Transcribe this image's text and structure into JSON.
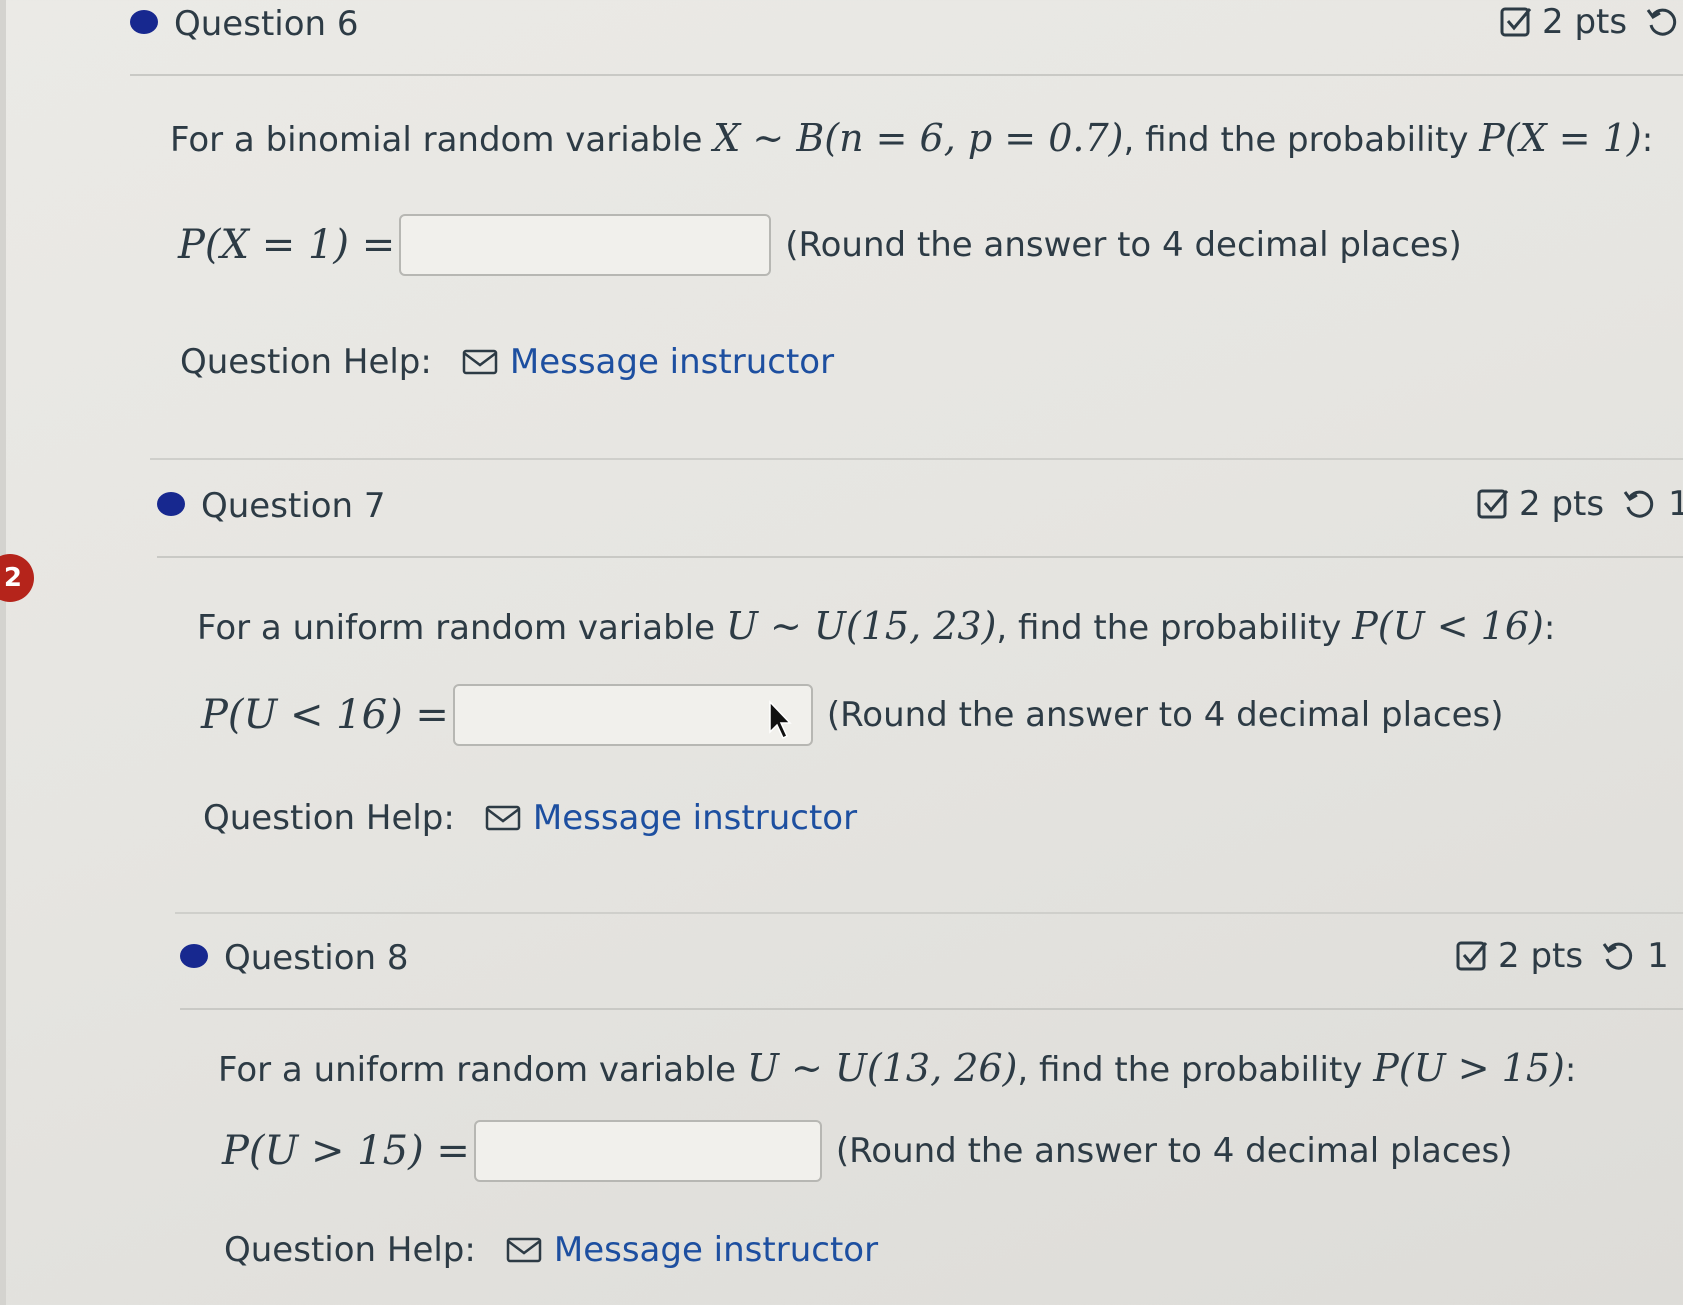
{
  "side_badge": "2",
  "questions": [
    {
      "title": "Question 6",
      "points": "2 pts",
      "retries": "",
      "prompt_prefix": "For a binomial random variable ",
      "prompt_math_1": "X ∼ B(n = 6, p = 0.7)",
      "prompt_mid": ", find the probability ",
      "prompt_math_2": "P(X = 1)",
      "prompt_suffix": ":",
      "answer_label": "P(X = 1) =",
      "answer_value": "",
      "note": "(Round the answer to 4 decimal places)",
      "help_label": "Question Help:",
      "help_link": "Message instructor"
    },
    {
      "title": "Question 7",
      "points": "2 pts",
      "retries": "1",
      "prompt_prefix": "For a uniform random variable ",
      "prompt_math_1": "U ∼ U(15, 23)",
      "prompt_mid": ", find the probability ",
      "prompt_math_2": "P(U < 16)",
      "prompt_suffix": ":",
      "answer_label": "P(U < 16) =",
      "answer_value": "",
      "note": "(Round the answer to 4 decimal places)",
      "help_label": "Question Help:",
      "help_link": "Message instructor"
    },
    {
      "title": "Question 8",
      "points": "2 pts",
      "retries": "1",
      "prompt_prefix": "For a uniform random variable ",
      "prompt_math_1": "U ∼ U(13, 26)",
      "prompt_mid": ", find the probability ",
      "prompt_math_2": "P(U > 15)",
      "prompt_suffix": ":",
      "answer_label": "P(U > 15) =",
      "answer_value": "",
      "note": "(Round the answer to 4 decimal places)",
      "help_label": "Question Help:",
      "help_link": "Message instructor"
    }
  ],
  "icons": {
    "status_dot": "question-status-dot-icon",
    "points": "checkbox-icon",
    "retry": "retry-icon",
    "help": "mail-icon"
  },
  "colors": {
    "status_dot": "#17288f",
    "link": "#1d4fa0",
    "badge": "#b5241b",
    "text": "#2d3b45"
  }
}
